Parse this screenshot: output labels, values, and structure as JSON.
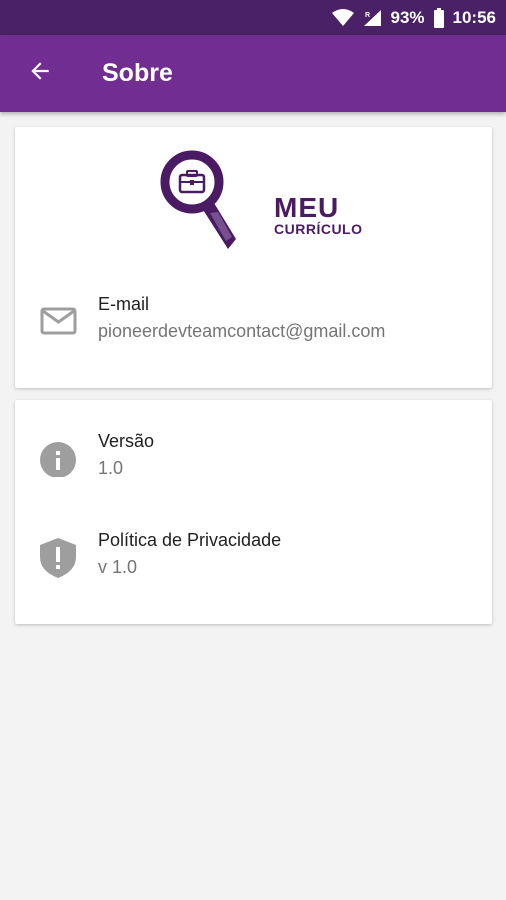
{
  "status_bar": {
    "battery": "93%",
    "time": "10:56",
    "icons": [
      "wifi-icon",
      "cell-signal-icon",
      "battery-icon"
    ]
  },
  "app_bar": {
    "title": "Sobre",
    "back_icon": "arrow-back-icon"
  },
  "logo": {
    "line1": "MEU",
    "line2": "CURRÍCULO"
  },
  "contact": {
    "label": "E-mail",
    "value": "pioneerdevteamcontact@gmail.com",
    "icon": "mail-icon"
  },
  "info": {
    "version": {
      "label": "Versão",
      "value": "1.0",
      "icon": "info-icon"
    },
    "privacy": {
      "label": "Política de Privacidade",
      "value": "v 1.0",
      "icon": "shield-alert-icon"
    }
  },
  "colors": {
    "status_bar": "#4a2166",
    "app_bar": "#722d93",
    "brand": "#4a1b63",
    "icon_gray": "#9e9e9e"
  }
}
